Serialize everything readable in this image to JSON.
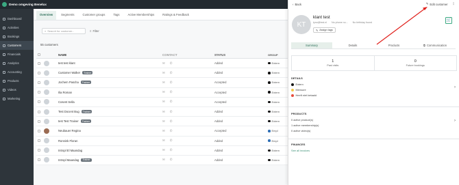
{
  "brand": {
    "title": "Demo omgeving Benelux"
  },
  "sidebar": {
    "items": [
      {
        "label": "Dashboard",
        "icon": "dashboard-icon"
      },
      {
        "label": "Activities",
        "icon": "activities-icon"
      },
      {
        "label": "Bookings",
        "icon": "bookings-icon"
      },
      {
        "label": "Customers",
        "icon": "customers-icon",
        "active": true
      },
      {
        "label": "Financials",
        "icon": "financials-icon"
      },
      {
        "label": "Analytics",
        "icon": "analytics-icon"
      },
      {
        "label": "Accounting",
        "icon": "accounting-icon"
      },
      {
        "label": "Products",
        "icon": "products-icon"
      },
      {
        "label": "Videos",
        "icon": "videos-icon"
      },
      {
        "label": "Marketing",
        "icon": "marketing-icon"
      }
    ]
  },
  "tabs": [
    "Overview",
    "Segments",
    "Customer groups",
    "Tags",
    "Active Memberships",
    "Ratings & Feedback"
  ],
  "search": {
    "placeholder": "Search for customer..."
  },
  "filter_label": "Filter",
  "customer_count": "55 customers",
  "table": {
    "headers": {
      "name": "NAME",
      "contact": "CONTACT",
      "status": "STATUS",
      "group": "GROUP"
    },
    "rows": [
      {
        "name": "test test klant",
        "badge": "",
        "status": "Added",
        "group": "Extern",
        "dot": "black",
        "photo": false
      },
      {
        "name": "Customer Walker",
        "badge": "Trainer",
        "status": "Added",
        "group": "Extern",
        "dot": "black",
        "photo": false
      },
      {
        "name": "Jochem Pascha",
        "badge": "Trainer",
        "status": "Accepted",
        "group": "Extern",
        "dot": "black",
        "photo": false
      },
      {
        "name": "Ilia Roman",
        "badge": "",
        "status": "Accepted",
        "group": "Extern",
        "dot": "black",
        "photo": false
      },
      {
        "name": "Cosent Sella",
        "badge": "",
        "status": "Accepted",
        "group": "Extern",
        "dot": "black",
        "photo": false
      },
      {
        "name": "Test Docent Bug",
        "badge": "Trainer",
        "status": "Added",
        "group": "Extern",
        "dot": "black",
        "photo": false
      },
      {
        "name": "test Test Trainer",
        "badge": "Trainer",
        "status": "Added",
        "group": "Extern",
        "dot": "black",
        "photo": false
      },
      {
        "name": "Neubauer Regina",
        "badge": "",
        "status": "Accepted",
        "group": "Empl",
        "dot": "blue",
        "photo": true
      },
      {
        "name": "Ronnink Floran",
        "badge": "",
        "status": "Added",
        "group": "Empl",
        "dot": "blue",
        "photo": false
      },
      {
        "name": "Intropl El Maandag",
        "badge": "",
        "status": "Added",
        "group": "Extern",
        "dot": "black",
        "photo": false
      },
      {
        "name": "Intropl Maandag",
        "badge": "Trainer",
        "status": "Added",
        "group": "Extern",
        "dot": "black",
        "photo": false
      }
    ]
  },
  "drawer": {
    "back_label": "Back",
    "edit_label": "Edit customer",
    "more_label": "⋮",
    "avatar_initials": "KT",
    "name": "klant test",
    "email": "tyno@test.nl",
    "phone": "No phone nu...",
    "birthday": "No birthday found",
    "assign_tags": "Assign tags",
    "tabs": [
      "Summary",
      "Details",
      "Products",
      "Communication"
    ],
    "stats": [
      {
        "value": "1",
        "label": "Past visits"
      },
      {
        "value": "0",
        "label": "Future bookings"
      }
    ],
    "details": {
      "title": "DETAILS",
      "lines": [
        {
          "text": "Extern",
          "color": "#111111"
        },
        {
          "text": "Mensure",
          "color": "#f2c94c"
        },
        {
          "text": "Heeft niet betaald",
          "color": "#e74c3c"
        }
      ]
    },
    "products": {
      "title": "PRODUCTS",
      "lines": [
        "0 active product(s)",
        "1 active membership(s)",
        "0 active video(s)"
      ]
    },
    "finances": {
      "title": "FINANCES",
      "link": "See all invoices"
    }
  },
  "colors": {
    "accent": "#3aa981",
    "sidebar": "#2e353b",
    "arrow": "#e0201b"
  }
}
